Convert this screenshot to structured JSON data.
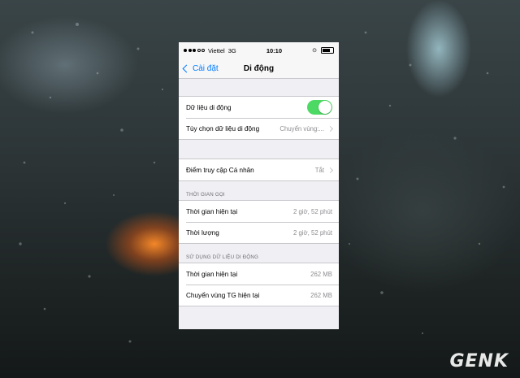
{
  "status_bar": {
    "carrier": "Viettel",
    "network": "3G",
    "time": "10:10"
  },
  "nav": {
    "back_label": "Cài đặt",
    "title": "Di động"
  },
  "group1": {
    "cellular_data_label": "Dữ liệu di động",
    "cellular_data_on": true,
    "options_label": "Tùy chọn dữ liệu di động",
    "options_value": "Chuyển vùng:..."
  },
  "group2": {
    "hotspot_label": "Điểm truy cập Cá nhân",
    "hotspot_value": "Tắt"
  },
  "call_time": {
    "header": "THỜI GIAN GỌI",
    "rows": [
      {
        "label": "Thời gian hiện tại",
        "value": "2 giờ, 52 phút"
      },
      {
        "label": "Thời lượng",
        "value": "2 giờ, 52 phút"
      }
    ]
  },
  "data_usage": {
    "header": "SỬ DỤNG DỮ LIỆU DI ĐỘNG",
    "rows": [
      {
        "label": "Thời gian hiện tại",
        "value": "262 MB"
      },
      {
        "label": "Chuyển vùng TG hiện tại",
        "value": "262 MB"
      }
    ]
  },
  "watermark": {
    "brand": "GENK"
  },
  "colors": {
    "accent": "#007aff",
    "toggle_on": "#4cd964",
    "background": "#efeff4"
  }
}
